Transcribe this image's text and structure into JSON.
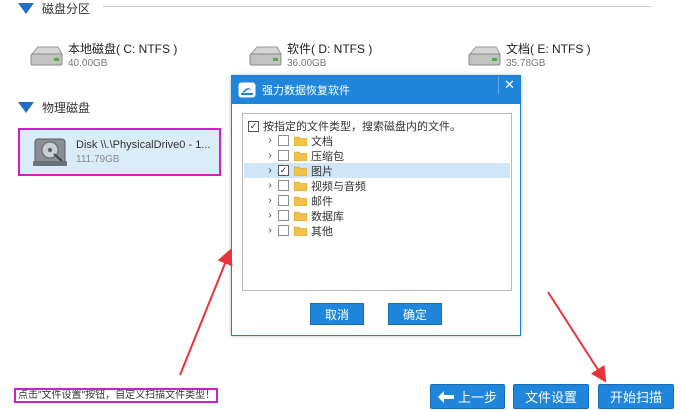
{
  "partition_section": {
    "title": "磁盘分区"
  },
  "drives": [
    {
      "name": "本地磁盘( C: NTFS )",
      "size": "40.00GB"
    },
    {
      "name": "软件( D: NTFS )",
      "size": "36.00GB"
    },
    {
      "name": "文档( E: NTFS )",
      "size": "35.78GB"
    }
  ],
  "physical_section": {
    "title": "物理磁盘"
  },
  "physical_drive": {
    "name": "Disk \\\\.\\PhysicalDrive0 - 1...",
    "size": "111.79GB"
  },
  "dialog": {
    "title": "强力数据恢复软件",
    "close": "✕",
    "root_label": "按指定的文件类型，搜索磁盘内的文件。",
    "items": [
      {
        "label": "文档",
        "checked": false
      },
      {
        "label": "压缩包",
        "checked": false
      },
      {
        "label": "图片",
        "checked": true
      },
      {
        "label": "视频与音频",
        "checked": false
      },
      {
        "label": "邮件",
        "checked": false
      },
      {
        "label": "数据库",
        "checked": false
      },
      {
        "label": "其他",
        "checked": false
      }
    ],
    "cancel_label": "取消",
    "ok_label": "确定"
  },
  "bottom": {
    "hint": "点击\"文件设置\"按钮，自定义扫描文件类型！",
    "back_label": "上一步",
    "settings_label": "文件设置",
    "scan_label": "开始扫描"
  },
  "colors": {
    "accent": "#1f86dc",
    "highlight_border": "#d21ec8",
    "arrow": "#e8333a"
  }
}
